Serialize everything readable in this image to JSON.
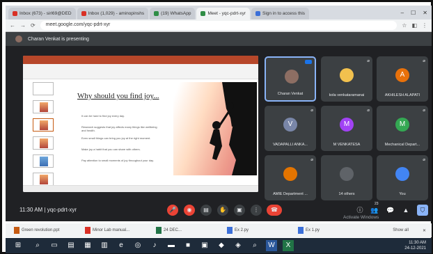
{
  "browser": {
    "tabs": [
      {
        "label": "Inbox (673) - sirl69@DED",
        "active": false
      },
      {
        "label": "Inbox (1,029) - aminopinshs",
        "active": false
      },
      {
        "label": "(19) WhatsApp",
        "active": false
      },
      {
        "label": "Meet - yqc-pdrt-xyr",
        "active": true
      },
      {
        "label": "Sign in to access this",
        "active": false
      }
    ],
    "url": "meet.google.com/yqc-pdrt-xyr"
  },
  "meet": {
    "presenting_banner": "Charan Venkat is presenting",
    "slide": {
      "title": "Why should you find joy...",
      "bullets": [
        "It can be hard to find joy every day.",
        "Research suggests that joy affects many things like wellbeing and health.",
        "Even small things can bring you joy at the right moment.",
        "Make joy a habit that you can share with others.",
        "Pay attention to small moments of joy throughout your day."
      ]
    },
    "participants": [
      {
        "name": "Charan Venkat",
        "initial": "",
        "avatar_color": "#8d6e63",
        "speaking": true
      },
      {
        "name": "kola venkataramanai",
        "initial": "",
        "avatar_color": "#f2c14e",
        "speaking": false
      },
      {
        "name": "AKHILESH ALAPATI",
        "initial": "A",
        "avatar_color": "#e8710a",
        "speaking": false
      },
      {
        "name": "VADAPALLI ANKA...",
        "initial": "V",
        "avatar_color": "#7986a8",
        "speaking": false
      },
      {
        "name": "M VENKATESA",
        "initial": "M",
        "avatar_color": "#a142f4",
        "speaking": false
      },
      {
        "name": "Mechanical Depart...",
        "initial": "M",
        "avatar_color": "#34a853",
        "speaking": false
      },
      {
        "name": "AMIE Department ...",
        "initial": "",
        "avatar_color": "#e37400",
        "speaking": false
      },
      {
        "name": "14 others",
        "initial": "",
        "avatar_color": "#5f6368",
        "speaking": false
      },
      {
        "name": "You",
        "initial": "",
        "avatar_color": "#4285f4",
        "speaking": false
      }
    ],
    "meeting_time": "11:30 AM",
    "meeting_code": "yqc-pdrt-xyr",
    "participant_count": "23",
    "activate_windows": "Activate Windows"
  },
  "downloads": {
    "items": [
      "Green revolution.ppt",
      "Minor Lab manual...",
      "24 DEC...",
      "Ex 2.py",
      "Ex 1.py"
    ],
    "show_all": "Show all"
  },
  "taskbar": {
    "time": "11:30 AM",
    "date": "24-12-2021"
  }
}
